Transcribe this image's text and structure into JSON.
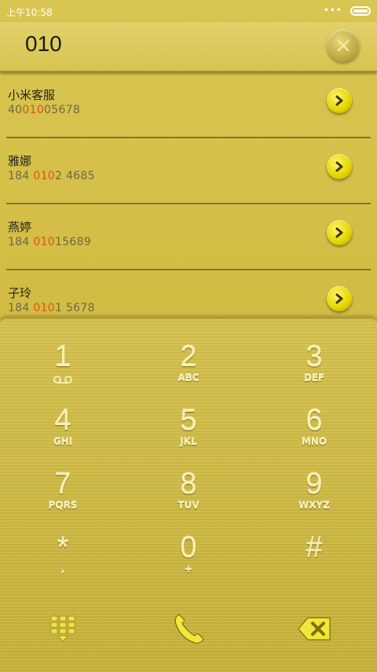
{
  "status_bar": {
    "time": "上午10:58",
    "dots": "•••"
  },
  "search": {
    "query": "010"
  },
  "contacts": [
    {
      "name": "小米客服",
      "number_parts": [
        "40",
        "010",
        "05678"
      ]
    },
    {
      "name": "雅娜",
      "number_parts": [
        "184 ",
        "010",
        "2 4685"
      ]
    },
    {
      "name": "燕婷",
      "number_parts": [
        "184 ",
        "010",
        "15689"
      ]
    },
    {
      "name": "子玲",
      "number_parts": [
        "184 ",
        "010",
        "1 5678"
      ]
    }
  ],
  "keys": [
    {
      "digit": "1",
      "letters": ""
    },
    {
      "digit": "2",
      "letters": "ABC"
    },
    {
      "digit": "3",
      "letters": "DEF"
    },
    {
      "digit": "4",
      "letters": "GHI"
    },
    {
      "digit": "5",
      "letters": "JKL"
    },
    {
      "digit": "6",
      "letters": "MNO"
    },
    {
      "digit": "7",
      "letters": "PQRS"
    },
    {
      "digit": "8",
      "letters": "TUV"
    },
    {
      "digit": "9",
      "letters": "WXYZ"
    },
    {
      "digit": "*",
      "letters": ","
    },
    {
      "digit": "0",
      "letters": "+"
    },
    {
      "digit": "#",
      "letters": ""
    }
  ],
  "colors": {
    "highlight": "#e25016",
    "accent_yellow": "#e4d400",
    "gold": "#d3bd45"
  }
}
